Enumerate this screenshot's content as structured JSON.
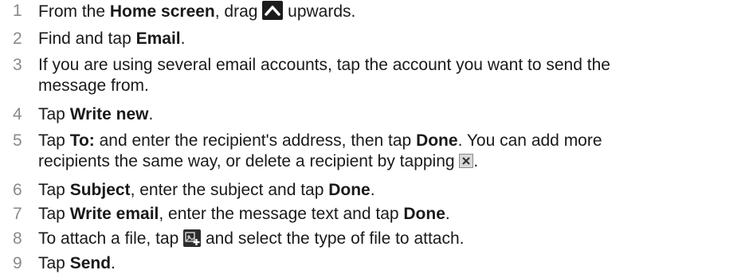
{
  "steps": [
    {
      "num": "1",
      "a": "From the ",
      "b": "Home screen",
      "c": ", drag ",
      "d": " upwards."
    },
    {
      "num": "2",
      "a": "Find and tap ",
      "b": "Email",
      "c": "."
    },
    {
      "num": "3",
      "line1": "If you are using several email accounts, tap the account you want to send the",
      "line2": "message from."
    },
    {
      "num": "4",
      "a": "Tap ",
      "b": "Write new",
      "c": "."
    },
    {
      "num": "5",
      "a": "Tap ",
      "b": "To:",
      "c": " and enter the recipient's address, then tap ",
      "d": "Done",
      "e": ". You can add more",
      "line2a": "recipients the same way, or delete a recipient by tapping ",
      "line2b": "."
    },
    {
      "num": "6",
      "a": "Tap ",
      "b": "Subject",
      "c": ", enter the subject and tap ",
      "d": "Done",
      "e": "."
    },
    {
      "num": "7",
      "a": "Tap ",
      "b": "Write email",
      "c": ", enter the message text and tap ",
      "d": "Done",
      "e": "."
    },
    {
      "num": "8",
      "a": "To attach a file, tap ",
      "c": " and select the type of file to attach."
    },
    {
      "num": "9",
      "a": "Tap ",
      "b": "Send",
      "c": "."
    }
  ],
  "icons": {
    "step1": "arrow-up-icon",
    "step5": "delete-recipient-icon",
    "step8": "attach-icon"
  }
}
